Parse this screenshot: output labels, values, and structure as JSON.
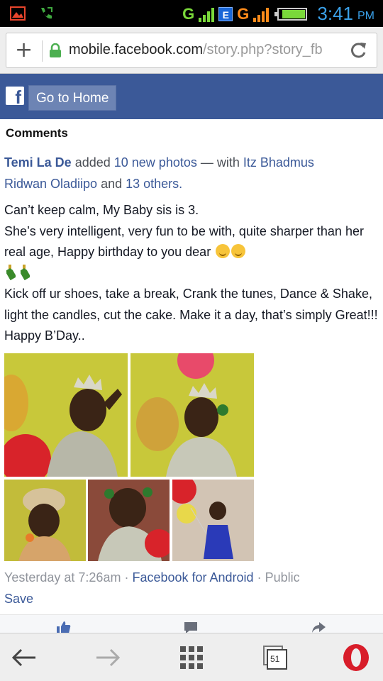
{
  "status_bar": {
    "time": "3:41",
    "ampm": "PM",
    "network_1": "G",
    "network_2_badge": "E",
    "network_2": "G"
  },
  "browser": {
    "url_host": "mobile.facebook.com",
    "url_path": "/story.php?story_fb",
    "tab_count": "51"
  },
  "fb_header": {
    "logo": "f",
    "go_home_label": "Go to Home"
  },
  "post": {
    "section_title": "Comments",
    "author": "Temi La De",
    "added_text": " added ",
    "photos_link": "10 new photos",
    "with_text": " — with ",
    "tagged_1": "Itz Bhadmus",
    "tagged_2": "Ridwan Oladiipo",
    "and_text": " and ",
    "others_link": "13 others.",
    "line1": "Can’t keep calm, My Baby sis is 3.",
    "line2": "She’s very intelligent, very fun to be with, quite sharper than her real age, Happy birthday to you dear",
    "line3": "Kick off ur shoes, take a break, Crank the tunes, Dance & Shake, light the candles, cut the cake. Make it a day, that’s simply Great!!! Happy B’Day..",
    "timestamp": "Yesterday at  7:26am",
    "dot": " · ",
    "via": "Facebook for Android",
    "privacy": "Public",
    "save_label": "Save"
  },
  "colors": {
    "fb_blue": "#3b5998",
    "link": "#3b5998",
    "photo_bg": "#c8c83a"
  }
}
